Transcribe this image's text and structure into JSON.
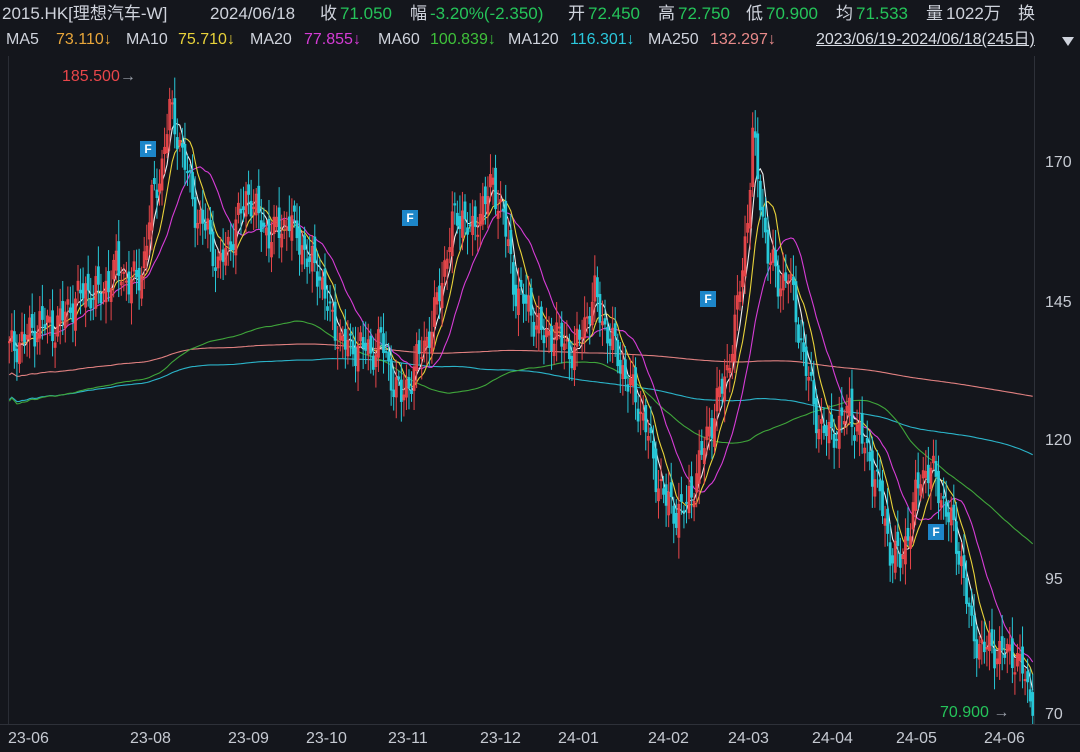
{
  "infobar": {
    "symbol": "2015.HK[理想汽车-W]",
    "date": "2024/06/18",
    "close_label": "收",
    "close_value": "71.050",
    "change_label": "幅",
    "change_value": "-3.20%(-2.350)",
    "open_label": "开",
    "open_value": "72.450",
    "high_label": "高",
    "high_value": "72.750",
    "low_label": "低",
    "low_value": "70.900",
    "avg_label": "均",
    "avg_value": "71.533",
    "vol_label": "量",
    "vol_value": "1022万",
    "turnover_label": "换"
  },
  "ma_bar": {
    "ma5_label": "MA5",
    "ma5_value": "73.110↓",
    "ma10_label": "MA10",
    "ma10_value": "75.710↓",
    "ma20_label": "MA20",
    "ma20_value": "77.855↓",
    "ma60_label": "MA60",
    "ma60_value": "100.839↓",
    "ma120_label": "MA120",
    "ma120_value": "116.301↓",
    "ma250_label": "MA250",
    "ma250_value": "132.297↓",
    "range": "2023/06/19-2024/06/18(245日)"
  },
  "colors": {
    "up": "#e8464a",
    "down": "#27c8d8",
    "ma5": "#f0f0f0",
    "ma10": "#e8d23a",
    "ma20": "#d63cd6",
    "ma60": "#3fa53a",
    "ma120": "#2bb3c8",
    "ma250": "#e08080"
  },
  "markers": {
    "high": "185.500",
    "low": "70.900",
    "flag": "F"
  },
  "chart_data": {
    "type": "candlestick",
    "y_ticks": [
      "170",
      "145",
      "120",
      "95",
      "70"
    ],
    "x_ticks": [
      "23-06",
      "23-08",
      "23-09",
      "23-10",
      "23-11",
      "23-12",
      "24-01",
      "24-02",
      "24-03",
      "24-04",
      "24-05",
      "24-06"
    ],
    "ylim": [
      67,
      190
    ],
    "close_path": [
      [
        0,
        136
      ],
      [
        6,
        138
      ],
      [
        12,
        141
      ],
      [
        18,
        140
      ],
      [
        24,
        144
      ],
      [
        30,
        147
      ],
      [
        36,
        146
      ],
      [
        42,
        151
      ],
      [
        48,
        148
      ],
      [
        52,
        150
      ],
      [
        56,
        163
      ],
      [
        60,
        170
      ],
      [
        63,
        180
      ],
      [
        66,
        176
      ],
      [
        70,
        168
      ],
      [
        74,
        160
      ],
      [
        78,
        158
      ],
      [
        82,
        151
      ],
      [
        86,
        155
      ],
      [
        90,
        160
      ],
      [
        94,
        165
      ],
      [
        98,
        160
      ],
      [
        102,
        157
      ],
      [
        106,
        158
      ],
      [
        110,
        160
      ],
      [
        114,
        156
      ],
      [
        118,
        152
      ],
      [
        122,
        150
      ],
      [
        126,
        142
      ],
      [
        130,
        138
      ],
      [
        134,
        136
      ],
      [
        138,
        137
      ],
      [
        142,
        135
      ],
      [
        146,
        138
      ],
      [
        150,
        131
      ],
      [
        154,
        127
      ],
      [
        158,
        131
      ],
      [
        162,
        136
      ],
      [
        166,
        140
      ],
      [
        170,
        149
      ],
      [
        174,
        159
      ],
      [
        178,
        161
      ],
      [
        182,
        157
      ],
      [
        186,
        163
      ],
      [
        190,
        166
      ],
      [
        194,
        161
      ],
      [
        198,
        148
      ],
      [
        202,
        145
      ],
      [
        206,
        142
      ],
      [
        210,
        138
      ],
      [
        214,
        139
      ],
      [
        218,
        137
      ],
      [
        222,
        135
      ],
      [
        226,
        141
      ],
      [
        230,
        146
      ],
      [
        234,
        140
      ],
      [
        238,
        136
      ],
      [
        242,
        131
      ],
      [
        246,
        127
      ],
      [
        250,
        122
      ],
      [
        254,
        113
      ],
      [
        258,
        108
      ],
      [
        262,
        106
      ],
      [
        266,
        107
      ],
      [
        270,
        113
      ],
      [
        274,
        120
      ],
      [
        278,
        126
      ],
      [
        282,
        132
      ],
      [
        286,
        143
      ],
      [
        290,
        160
      ],
      [
        292,
        176
      ],
      [
        294,
        167
      ],
      [
        298,
        154
      ],
      [
        302,
        148
      ],
      [
        306,
        150
      ],
      [
        310,
        140
      ],
      [
        314,
        130
      ],
      [
        318,
        122
      ],
      [
        322,
        120
      ],
      [
        326,
        122
      ],
      [
        330,
        125
      ],
      [
        334,
        120
      ],
      [
        338,
        116
      ],
      [
        342,
        109
      ],
      [
        346,
        99
      ],
      [
        350,
        97
      ],
      [
        354,
        104
      ],
      [
        358,
        113
      ],
      [
        362,
        114
      ],
      [
        366,
        109
      ],
      [
        370,
        104
      ],
      [
        374,
        97
      ],
      [
        378,
        84
      ],
      [
        382,
        81
      ],
      [
        386,
        81
      ],
      [
        390,
        80
      ],
      [
        394,
        80
      ],
      [
        398,
        77
      ],
      [
        400,
        73
      ],
      [
        402,
        72
      ]
    ]
  }
}
